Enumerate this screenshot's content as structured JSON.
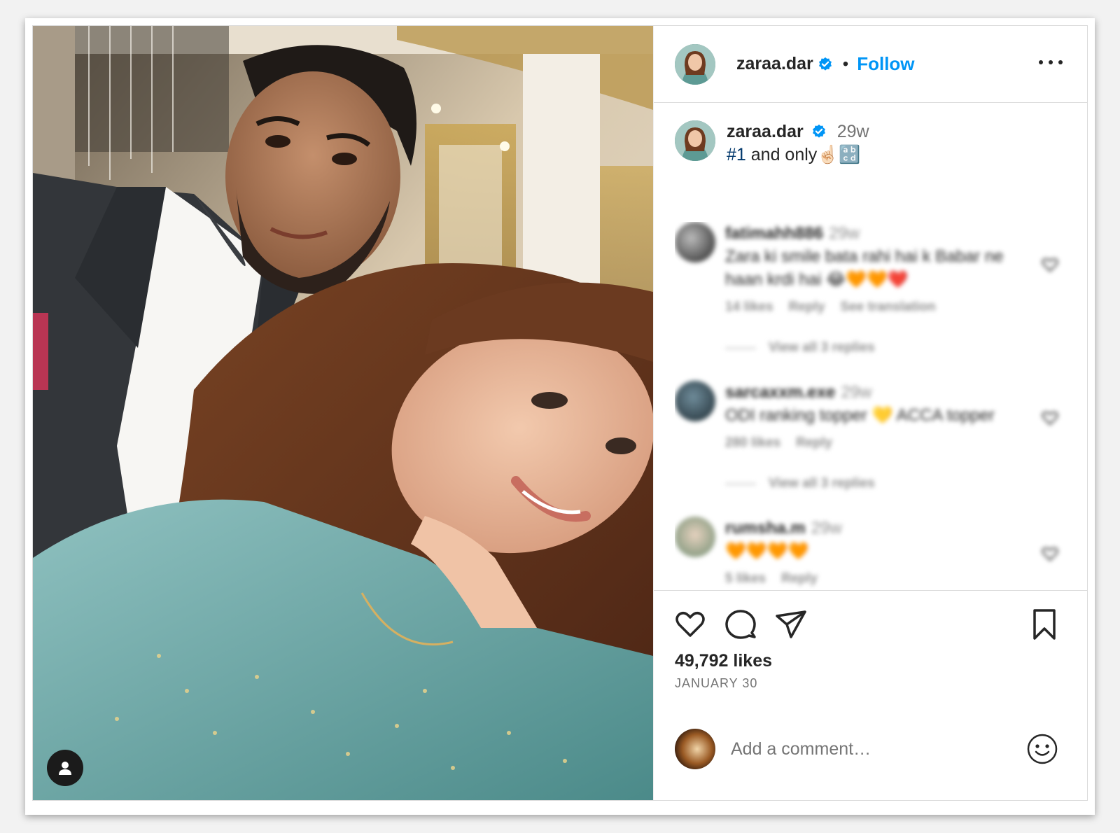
{
  "post": {
    "username": "zaraa.dar",
    "separator": "•",
    "follow_label": "Follow",
    "caption": {
      "username": "zaraa.dar",
      "time": "29w",
      "hashtag": "#1",
      "text": " and only☝🏻",
      "emoji_box": "🔡"
    },
    "comments": [
      {
        "username": "fatimahh886",
        "time": "29w",
        "text": "Zara ki smile bata rahi hai k Babar ne haan krdi hai 😂🧡🧡❤️",
        "likes": "14 likes",
        "reply": "Reply",
        "translate": "See translation",
        "view_replies": "View all 3 replies"
      },
      {
        "username": "sarcaxxm.exe",
        "time": "29w",
        "text": "ODI ranking topper 💛 ACCA topper",
        "likes": "280 likes",
        "reply": "Reply",
        "view_replies": "View all 3 replies"
      },
      {
        "username": "rumsha.m",
        "time": "29w",
        "text": "🧡🧡🧡🧡",
        "likes": "5 likes",
        "reply": "Reply"
      }
    ],
    "likes": "49,792 likes",
    "date": "JANUARY 30",
    "add_comment_placeholder": "Add a comment…",
    "colors": {
      "accent": "#0095f6",
      "verified": "#0095f6",
      "hashtag": "#00376b",
      "muted": "#737373"
    },
    "icons": [
      "heart-icon",
      "comment-icon",
      "share-icon",
      "bookmark-icon",
      "emoji-icon",
      "more-icon",
      "user-tag-icon",
      "verified-badge-icon"
    ]
  }
}
